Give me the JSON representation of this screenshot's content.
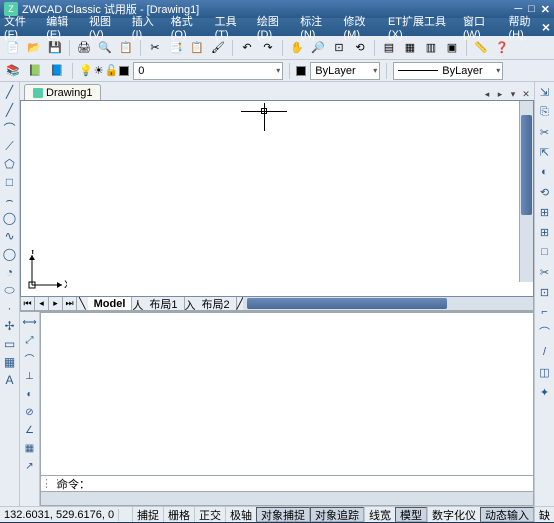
{
  "window": {
    "title": "ZWCAD Classic 试用版 - [Drawing1]"
  },
  "menu": {
    "file": "文件(F)",
    "edit": "编辑(E)",
    "view": "视图(V)",
    "insert": "插入(I)",
    "format": "格式(O)",
    "tools": "工具(T)",
    "draw": "绘图(D)",
    "dim": "标注(N)",
    "modify": "修改(M)",
    "et": "ET扩展工具(X)",
    "window": "窗口(W)",
    "help": "帮助(H)"
  },
  "tab": {
    "name": "Drawing1"
  },
  "layer": {
    "current": "0"
  },
  "props": {
    "bylayer": "ByLayer",
    "linetype": "ByLayer"
  },
  "sheets": {
    "model": "Model",
    "layout1": "布局1",
    "layout2": "布局2"
  },
  "cmd": {
    "prompt": "命令："
  },
  "status": {
    "coords": "132.6031, 529.6176, 0",
    "snap": "捕捉",
    "grid": "栅格",
    "ortho": "正交",
    "polar": "极轴",
    "osnap": "对象捕捉",
    "otrack": "对象追踪",
    "lw": "线宽",
    "model": "模型",
    "digit": "数字化仪",
    "dyn": "动态输入",
    "ann": "缺"
  },
  "ucs": {
    "x": "X",
    "y": "Y"
  },
  "lefttool_icons": [
    "╱",
    "╱",
    "⌒",
    "⟋",
    "⬠",
    "□",
    "⌢",
    "◯",
    "∿",
    "◯",
    "◔",
    "⬭",
    "·",
    "✢",
    "▭",
    "▦",
    "A"
  ],
  "righttool_icons": [
    "⇲",
    "⎘",
    "✂",
    "⇱",
    "◐",
    "⟲",
    "⊞",
    "⊞",
    "□",
    "✂",
    "⊡",
    "⌐",
    "⌒",
    "/",
    "◫",
    "✦"
  ]
}
